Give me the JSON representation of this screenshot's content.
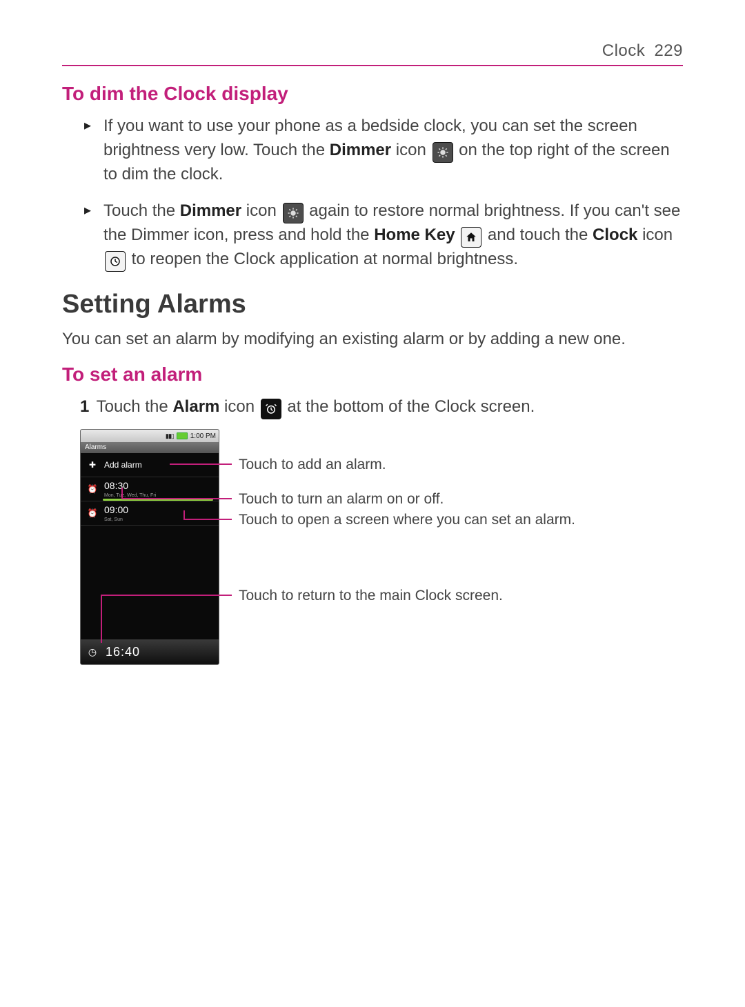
{
  "header": {
    "section": "Clock",
    "page_number": "229"
  },
  "sec_dim": {
    "heading": "To dim the Clock display",
    "b1_a": "If you want to use your phone as a bedside clock, you can set the screen brightness very low. Touch the ",
    "b1_bold1": "Dimmer",
    "b1_b": " icon ",
    "b1_c": " on the top right of the screen to dim the clock.",
    "b2_a": "Touch the ",
    "b2_bold1": "Dimmer",
    "b2_b": " icon ",
    "b2_c": " again to restore normal brightness. If you can't see the Dimmer icon, press and hold the ",
    "b2_bold2": "Home Key",
    "b2_d": " and touch the ",
    "b2_bold3": "Clock",
    "b2_e": " icon ",
    "b2_f": " to reopen the Clock application at normal brightness."
  },
  "sec_alarms": {
    "heading": "Setting Alarms",
    "intro": "You can set an alarm by modifying an existing alarm or by adding a new one."
  },
  "sec_set": {
    "heading": "To set an alarm",
    "step1_num": "1",
    "step1_a": "Touch the ",
    "step1_bold": "Alarm",
    "step1_b": " icon ",
    "step1_c": " at the bottom of the Clock screen."
  },
  "phone": {
    "status_time": "1:00 PM",
    "titlebar": "Alarms",
    "add_label": "Add alarm",
    "alarm1_time": "08:30",
    "alarm1_days": "Mon, Tue, Wed, Thu, Fri",
    "alarm2_time": "09:00",
    "alarm2_days": "Sat, Sun",
    "footer_time": "16:40"
  },
  "callouts": {
    "c1": "Touch to add an alarm.",
    "c2": "Touch to turn an alarm on or off.",
    "c3a": "Touch to open a screen where you can set an alarm.",
    "c4": "Touch to return to the main Clock screen."
  }
}
